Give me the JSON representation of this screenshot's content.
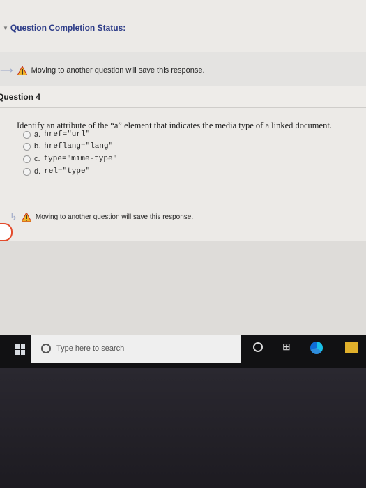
{
  "header": {
    "status_label": "Question Completion Status:",
    "caret_icon": "triangle-down-icon"
  },
  "top_notice": {
    "text": "Moving to another question will save this response.",
    "icons": [
      "forward-arrow-icon",
      "warning-icon"
    ]
  },
  "question": {
    "title": "Question 4",
    "prompt": "Identify an attribute of the “a” element that indicates the media type of a linked document.",
    "options": [
      {
        "prefix": "a.",
        "code": "href=\"url\""
      },
      {
        "prefix": "b.",
        "code": "hreflang=\"lang\""
      },
      {
        "prefix": "c.",
        "code": "type=\"mime-type\""
      },
      {
        "prefix": "d.",
        "code": "rel=\"type\""
      }
    ]
  },
  "bottom_notice": {
    "text": "Moving to another question will save this response.",
    "icons": [
      "forward-arrow-icon",
      "warning-icon"
    ]
  },
  "taskbar": {
    "search_placeholder": "Type here to search",
    "icons": [
      "windows-start-icon",
      "search-icon",
      "cortana-icon",
      "task-view-icon",
      "edge-icon",
      "file-explorer-icon"
    ]
  },
  "colors": {
    "accent_blue": "#2d3c88",
    "warning_red": "#e34b2b",
    "taskbar_bg": "#111113"
  }
}
